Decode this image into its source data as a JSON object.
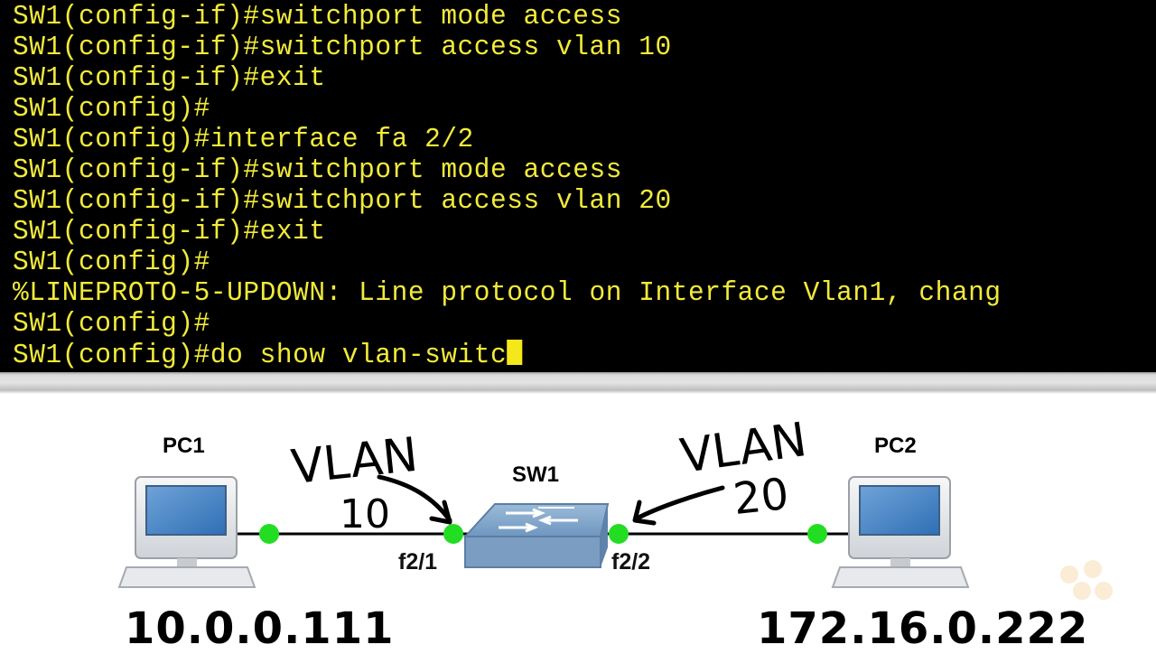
{
  "terminal": {
    "lines": [
      "SW1(config-if)#switchport mode access",
      "SW1(config-if)#switchport access vlan 10",
      "SW1(config-if)#exit",
      "SW1(config)#",
      "SW1(config)#interface fa 2/2",
      "SW1(config-if)#switchport mode access",
      "SW1(config-if)#switchport access vlan 20",
      "SW1(config-if)#exit",
      "SW1(config)#",
      "%LINEPROTO-5-UPDOWN: Line protocol on Interface Vlan1, chang",
      "SW1(config)#"
    ],
    "input_line": "SW1(config)#do show vlan-switc",
    "text_color": "#f1ea3a"
  },
  "diagram": {
    "devices": {
      "pc1": {
        "label": "PC1",
        "icon": "desktop-computer-icon"
      },
      "sw1": {
        "label": "SW1",
        "icon": "network-switch-icon"
      },
      "pc2": {
        "label": "PC2",
        "icon": "desktop-computer-icon"
      }
    },
    "ports": {
      "sw1_left": "f2/1",
      "sw1_right": "f2/2"
    },
    "annotations": {
      "vlan10_line1": "VLAN",
      "vlan10_line2": "10",
      "vlan20_line1": "VLAN",
      "vlan20_line2": "20"
    },
    "ips": {
      "pc1": "10.0.0.111",
      "pc2": "172.16.0.222"
    },
    "link_up_color": "#22dd22"
  },
  "watermark": {
    "icon": "dots-logo-icon"
  }
}
